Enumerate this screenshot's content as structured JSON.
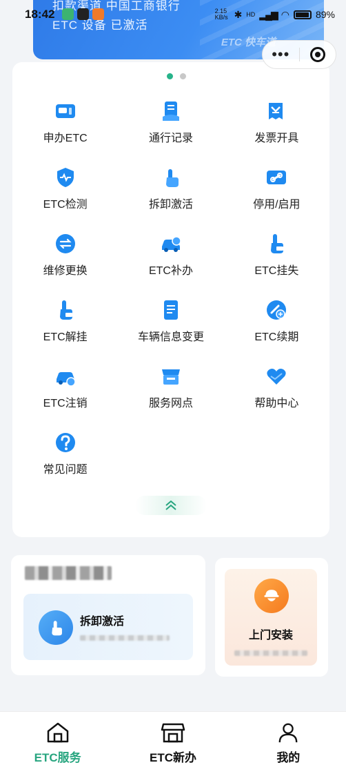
{
  "status_bar": {
    "time": "18:42",
    "network_speed": "2.15 KB/s",
    "signal_label": "HD",
    "battery_text": "89%"
  },
  "banner": {
    "line1": "扣款渠道    中国工商银行",
    "line2": "ETC 设备    已激活",
    "brand": "ETC 快车道"
  },
  "capsule": {
    "more_icon": "more-dots-icon",
    "close_icon": "target-icon"
  },
  "pager": {
    "count": 2,
    "active_index": 0
  },
  "menu": {
    "items": [
      {
        "label": "申办ETC",
        "icon": "etc-card-icon"
      },
      {
        "label": "通行记录",
        "icon": "car-record-icon"
      },
      {
        "label": "发票开具",
        "icon": "invoice-icon"
      },
      {
        "label": "ETC检测",
        "icon": "shield-pulse-icon"
      },
      {
        "label": "拆卸激活",
        "icon": "hand-touch-icon"
      },
      {
        "label": "停用/启用",
        "icon": "link-card-icon"
      },
      {
        "label": "维修更换",
        "icon": "swap-icon"
      },
      {
        "label": "ETC补办",
        "icon": "car-reissue-icon"
      },
      {
        "label": "ETC挂失",
        "icon": "hand-lost-icon"
      },
      {
        "label": "ETC解挂",
        "icon": "hand-lost-icon"
      },
      {
        "label": "车辆信息变更",
        "icon": "document-edit-icon"
      },
      {
        "label": "ETC续期",
        "icon": "renew-icon"
      },
      {
        "label": "ETC注销",
        "icon": "car-cancel-icon"
      },
      {
        "label": "服务网点",
        "icon": "store-icon"
      },
      {
        "label": "帮助中心",
        "icon": "heart-hand-icon"
      },
      {
        "label": "常见问题",
        "icon": "question-icon"
      }
    ],
    "collapse_icon": "chevron-up-double-icon"
  },
  "cards": {
    "dismantle_title": "拆卸激活",
    "install_title": "上门安装"
  },
  "tabbar": {
    "tabs": [
      {
        "label": "ETC服务",
        "icon": "home-icon",
        "active": true
      },
      {
        "label": "ETC新办",
        "icon": "shop-icon",
        "active": false
      },
      {
        "label": "我的",
        "icon": "person-icon",
        "active": false
      }
    ]
  },
  "colors": {
    "accent": "#27a57f",
    "primary_blue": "#2d86e9",
    "orange": "#f57a1e"
  }
}
